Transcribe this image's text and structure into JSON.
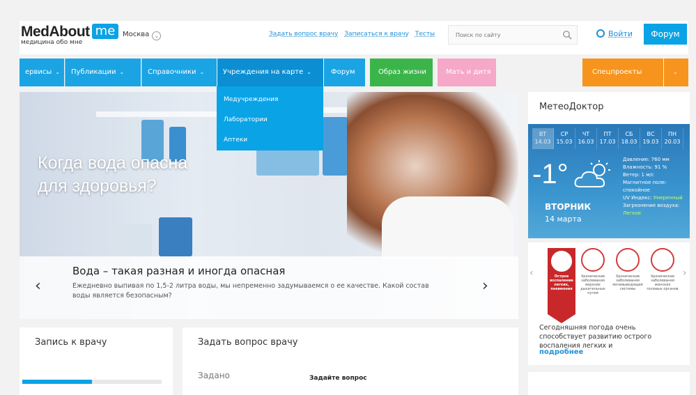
{
  "header": {
    "logo_main": "MedAbout",
    "logo_me": "me",
    "logo_sub": "медицина обо мне",
    "city": "Москва",
    "links": [
      "Задать вопрос врачу",
      "Записаться к врачу",
      "Тесты"
    ],
    "search_placeholder": "Поиск по сайту",
    "login": "Войти",
    "forum": "Форум"
  },
  "nav": {
    "items": [
      {
        "label": "ервисы"
      },
      {
        "label": "Публикации"
      },
      {
        "label": "Справочники"
      },
      {
        "label": "Учреждения на карте"
      },
      {
        "label": "Форум"
      },
      {
        "label": "Образ жизни"
      },
      {
        "label": "Мать и дитя"
      },
      {
        "label": "Спецпроекты"
      }
    ],
    "dropdown": [
      "Медучреждения",
      "Лаборатории",
      "Аптеки"
    ]
  },
  "hero": {
    "title_line1": "Когда вода опасна",
    "title_line2": "для здоровья?",
    "caption_title": "Вода – такая разная и иногда опасная",
    "caption_text": "Ежедневно выпивая по 1,5-2 литра воды, мы непременно задумываемся о ее качестве. Какой состав воды является безопасным?"
  },
  "meteo": {
    "title": "МетеоДоктор",
    "days": [
      {
        "dow": "ВТ",
        "date": "14.03"
      },
      {
        "dow": "СР",
        "date": "15.03"
      },
      {
        "dow": "ЧТ",
        "date": "16.03"
      },
      {
        "dow": "ПТ",
        "date": "17.03"
      },
      {
        "dow": "СБ",
        "date": "18.03"
      },
      {
        "dow": "ВС",
        "date": "19.03"
      },
      {
        "dow": "ПН",
        "date": "20.03"
      }
    ],
    "temp": "-1°",
    "weekday": "ВТОРНИК",
    "date": "14 марта",
    "details": {
      "pressure": "Давление: 760 мм",
      "humidity": "Влажность: 91 %",
      "wind": "Ветер: 1 м/с",
      "magnetic": "Магнитное поле: спокойное",
      "uv_label": "UV Индекс:",
      "uv_value": "Умеренный",
      "pollution_label": "Загрязнение воздуха:",
      "pollution_value": "Легкое"
    }
  },
  "health": {
    "risks": [
      "Острое воспаление легких, пневмония",
      "Хронические заболевания верхних дыхательных путей",
      "Хронические заболевания мочевыводящей системы",
      "Хронические заболевания женских половых органов"
    ],
    "text": "Сегодняшняя погода очень способствует развитию острого воспаления легких и",
    "more": "подробнее"
  },
  "cards": {
    "appointment_title": "Запись к врачу",
    "question_title": "Задать вопрос врачу",
    "asked_label": "Задано",
    "ask_label": "Задайте вопрос"
  },
  "colors": {
    "brand_blue": "#0aa3e6",
    "green": "#3bb54a",
    "pink": "#f6a8c8",
    "orange": "#f7941d",
    "red": "#c8282a"
  }
}
